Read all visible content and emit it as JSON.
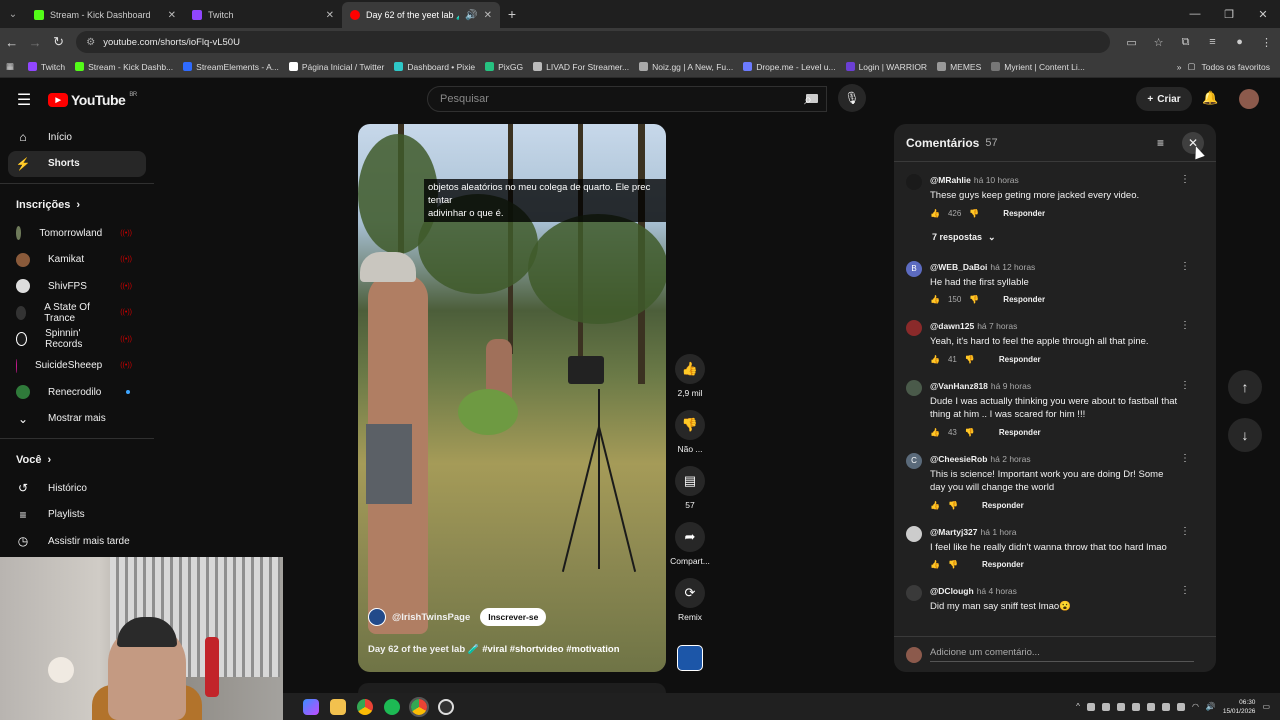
{
  "browser": {
    "tabs": [
      {
        "title": "Stream - Kick Dashboard",
        "favicon_color": "#53fc18",
        "active": false
      },
      {
        "title": "Twitch",
        "favicon_color": "#9146ff",
        "active": false
      },
      {
        "title": "Day 62 of the yeet lab 🧪 #",
        "favicon_color": "#ff0000",
        "active": true
      }
    ],
    "url": "youtube.com/shorts/ioFlq-vL50U",
    "bookmarks": [
      {
        "label": "Twitch",
        "color": "#9146ff"
      },
      {
        "label": "Stream - Kick Dashb...",
        "color": "#53fc18"
      },
      {
        "label": "StreamElements - A...",
        "color": "#2f6bff"
      },
      {
        "label": "Página Inicial / Twitter",
        "color": "#ffffff"
      },
      {
        "label": "Dashboard • Pixie",
        "color": "#2ec8c8"
      },
      {
        "label": "PixGG",
        "color": "#26c281"
      },
      {
        "label": "LIVAD For Streamer...",
        "color": "#bbbbbb"
      },
      {
        "label": "Noiz.gg | A New, Fu...",
        "color": "#aaaaaa"
      },
      {
        "label": "Drope.me - Level u...",
        "color": "#6c7bff"
      },
      {
        "label": "Login | WARRIOR",
        "color": "#6b3fd4"
      },
      {
        "label": "MEMES",
        "color": "#999999"
      },
      {
        "label": "Myrient | Content Li...",
        "color": "#777777"
      }
    ],
    "bookmarks_all": "Todos os favoritos"
  },
  "header": {
    "logo_text": "YouTube",
    "region": "BR",
    "search_placeholder": "Pesquisar",
    "create_label": "Criar"
  },
  "sidebar": {
    "home": "Início",
    "shorts": "Shorts",
    "subscriptions_heading": "Inscrições",
    "channels": [
      {
        "name": "Tomorrowland",
        "color": "#6e7a5a",
        "live": true
      },
      {
        "name": "Kamikat",
        "color": "#8a5a3a",
        "live": true
      },
      {
        "name": "ShivFPS",
        "color": "#dddddd",
        "live": true
      },
      {
        "name": "A State Of Trance",
        "color": "#333333",
        "live": true
      },
      {
        "name": "Spinnin' Records",
        "color": "#1a1a1a",
        "live": true
      },
      {
        "name": "SuicideSheeep",
        "color": "#c01a8a",
        "live": true
      },
      {
        "name": "Renecrodilo",
        "color": "#2f7a3a",
        "live": false
      }
    ],
    "show_more": "Mostrar mais",
    "you_heading": "Você",
    "history": "Histórico",
    "playlists": "Playlists",
    "watch_later": "Assistir mais tarde"
  },
  "video": {
    "caption_line1": "objetos aleatórios no meu colega de quarto.  Ele prec",
    "caption_line2": "tentar",
    "caption_line3": "adivinhar o que é.",
    "channel_handle": "@IrishTwinsPage",
    "subscribe_label": "Inscrever-se",
    "title": "Day 62 of the yeet lab 🧪",
    "tags": "#viral #shortvideo #motivation",
    "likes": "2,9 mil",
    "dislike_label": "Não ...",
    "comment_count": "57",
    "share_label": "Compart...",
    "remix_label": "Remix"
  },
  "comments": {
    "title": "Comentários",
    "count": "57",
    "reply_label": "Responder",
    "add_placeholder": "Adicione um comentário...",
    "items": [
      {
        "author": "@MRahlie",
        "time": "há 10 horas",
        "text": "These guys keep geting more jacked every video.",
        "likes": "426",
        "avatar": "",
        "avatar_color": "#1a1a1a",
        "replies": "7 respostas"
      },
      {
        "author": "@WEB_DaBoi",
        "time": "há 12 horas",
        "text": "He had the first syllable",
        "likes": "150",
        "avatar": "B",
        "avatar_color": "#5c6bc0",
        "replies": ""
      },
      {
        "author": "@dawn125",
        "time": "há 7 horas",
        "text": "Yeah, it's hard to feel the apple through all that pine.",
        "likes": "41",
        "avatar": "",
        "avatar_color": "#8a2a2a",
        "replies": ""
      },
      {
        "author": "@VanHanz818",
        "time": "há 9 horas",
        "text": "Dude I was actually thinking you were about to fastball that thing at him .. I was scared for him !!!",
        "likes": "43",
        "avatar": "",
        "avatar_color": "#4a5a4a",
        "replies": ""
      },
      {
        "author": "@CheesieRob",
        "time": "há 2 horas",
        "text": "This is science! Important work you are doing Dr! Some day you will change the world",
        "likes": "",
        "avatar": "C",
        "avatar_color": "#5a6a7a",
        "replies": ""
      },
      {
        "author": "@Martyj327",
        "time": "há 1 hora",
        "text": "I feel like he really didn't wanna throw that too hard lmao",
        "likes": "",
        "avatar": "",
        "avatar_color": "#cccccc",
        "replies": ""
      },
      {
        "author": "@DClough",
        "time": "há 4 horas",
        "text": "Did my man say sniff test lmao😮",
        "likes": "",
        "avatar": "",
        "avatar_color": "#3a3a3a",
        "replies": ""
      }
    ]
  },
  "taskbar": {
    "time": "06:30",
    "date": "15/01/2026"
  }
}
